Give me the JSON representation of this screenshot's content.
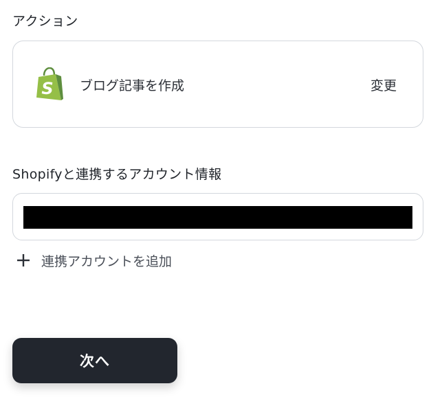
{
  "action_section": {
    "label": "アクション",
    "action_name": "ブログ記事を作成",
    "change_label": "変更",
    "app_icon": "shopify-bag-icon",
    "app_color": "#95bf47"
  },
  "account_section": {
    "label": "Shopifyと連携するアカウント情報",
    "add_account_label": "連携アカウントを追加",
    "add_icon": "plus-icon"
  },
  "footer": {
    "next_label": "次へ",
    "next_color": "#22262e"
  }
}
